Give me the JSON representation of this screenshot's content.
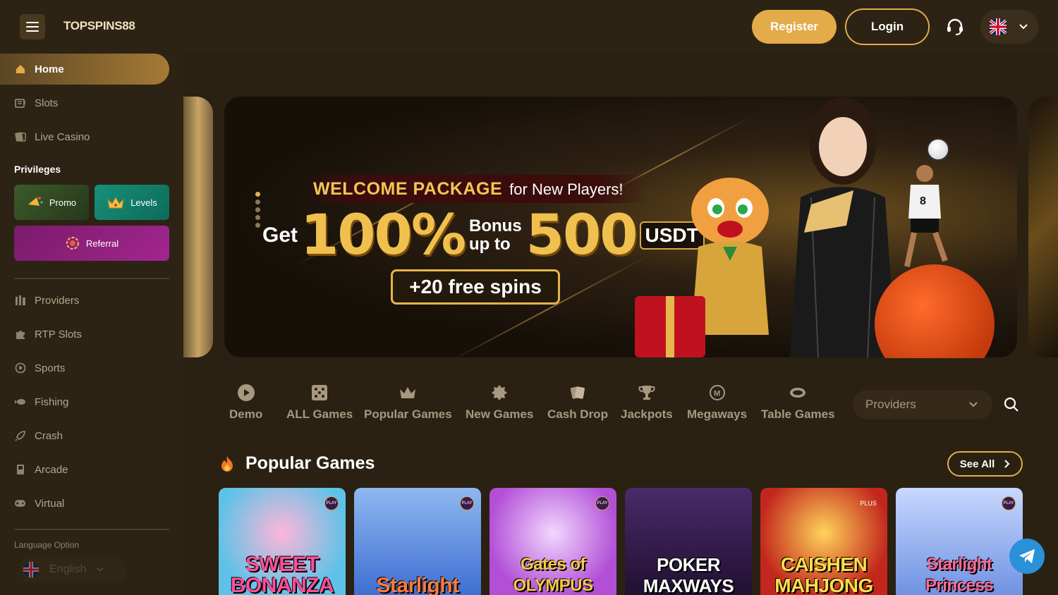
{
  "header": {
    "logo": "TOPSPINS88",
    "register_label": "Register",
    "login_label": "Login"
  },
  "sidebar": {
    "items_top": [
      {
        "label": "Home",
        "icon": "home-icon"
      },
      {
        "label": "Slots",
        "icon": "slots-icon"
      },
      {
        "label": "Live Casino",
        "icon": "live-casino-icon"
      }
    ],
    "privileges_title": "Privileges",
    "privileges": {
      "promo": "Promo",
      "levels": "Levels",
      "referral": "Referral"
    },
    "items_bottom": [
      {
        "label": "Providers",
        "icon": "providers-icon"
      },
      {
        "label": "RTP Slots",
        "icon": "puzzle-icon"
      },
      {
        "label": "Sports",
        "icon": "soccer-ball-icon"
      },
      {
        "label": "Fishing",
        "icon": "fish-icon"
      },
      {
        "label": "Crash",
        "icon": "rocket-icon"
      },
      {
        "label": "Arcade",
        "icon": "arcade-icon"
      },
      {
        "label": "Virtual",
        "icon": "gamepad-icon"
      }
    ],
    "language_title": "Language Option",
    "language_value": "English"
  },
  "banner": {
    "welcome_bold": "WELCOME PACKAGE",
    "welcome_rest": "for New Players!",
    "get": "Get",
    "percent": "100%",
    "bonus": "Bonus",
    "up_to": "up to",
    "amount": "500",
    "currency": "USDT",
    "spins": "+20 free spins",
    "ball_number": "8"
  },
  "categories": [
    {
      "label": "Demo",
      "icon": "play-circle-icon"
    },
    {
      "label": "ALL Games",
      "icon": "dice-icon"
    },
    {
      "label": "Popular Games",
      "icon": "crown-icon"
    },
    {
      "label": "New Games",
      "icon": "new-badge-icon"
    },
    {
      "label": "Cash Drop",
      "icon": "cards-icon"
    },
    {
      "label": "Jackpots",
      "icon": "trophy-icon"
    },
    {
      "label": "Megaways",
      "icon": "megaways-icon"
    },
    {
      "label": "Table Games",
      "icon": "table-icon"
    }
  ],
  "providers_select": "Providers",
  "popular": {
    "title": "Popular Games",
    "see_all": "See All",
    "games": [
      {
        "title": "SWEET BONANZA",
        "badge": "PLAY"
      },
      {
        "title": "Starlight",
        "badge": "PLAY"
      },
      {
        "title": "Gates of OLYMPUS",
        "badge": "PLAY"
      },
      {
        "title": "POKER MAXWAYS",
        "badge": ""
      },
      {
        "title": "CAISHEN MAHJONG",
        "badge": "PLUS"
      },
      {
        "title": "Starlight Princess",
        "badge": "PLAY"
      }
    ]
  },
  "colors": {
    "accent": "#e3ab4a",
    "background": "#2a2113",
    "sidebar": "#2c2314"
  }
}
